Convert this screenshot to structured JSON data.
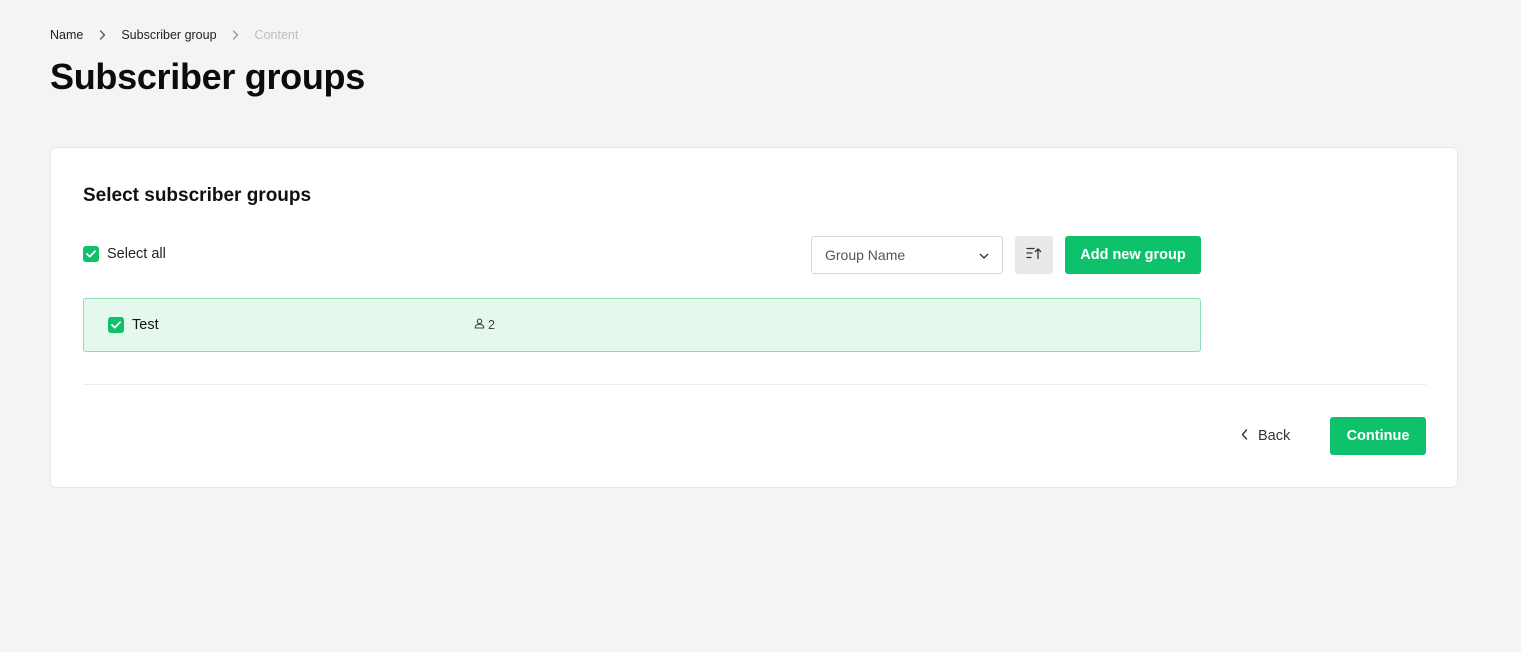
{
  "breadcrumb": {
    "items": [
      "Name",
      "Subscriber group",
      "Content"
    ]
  },
  "page": {
    "title": "Subscriber groups"
  },
  "card": {
    "title": "Select subscriber groups",
    "select_all_label": "Select all",
    "select_all_checked": true,
    "sort_dropdown": {
      "selected": "Group Name"
    },
    "add_button_label": "Add new group",
    "groups": [
      {
        "name": "Test",
        "subscriber_count": "2",
        "checked": true
      }
    ],
    "back_label": "Back",
    "continue_label": "Continue"
  },
  "colors": {
    "accent": "#0ec26b",
    "row_selected_bg": "#e5f8ee",
    "row_selected_border": "#8fdcb5",
    "page_bg": "#f3f4f6"
  },
  "icons": {
    "breadcrumb_separator": "chevron-right-icon",
    "checkbox": "check-icon",
    "dropdown": "chevron-down-icon",
    "sort": "sort-ascending-icon",
    "subscribers": "user-icon",
    "back": "chevron-left-icon"
  }
}
